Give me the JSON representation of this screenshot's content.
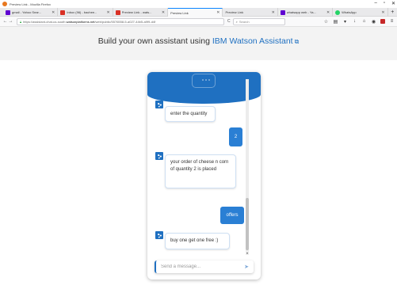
{
  "window": {
    "title": "Preview Link - Mozilla Firefox",
    "controls": [
      "–",
      "▫",
      "✕"
    ]
  },
  "tabs": [
    {
      "label": "gmail - Yahoo Sear...",
      "favicon_color": "#5f01d1"
    },
    {
      "label": "Inbox (96) - bachee...",
      "favicon_color": "#d93025"
    },
    {
      "label": "Preview Link - wats...",
      "favicon_color": "#d93025"
    },
    {
      "label": "Preview Link",
      "favicon_color": "#9e9e9e",
      "active": true
    },
    {
      "label": "Preview Link",
      "favicon_color": "#9e9e9e"
    },
    {
      "label": "whatsapp web - Ya...",
      "favicon_color": "#5f01d1"
    },
    {
      "label": "WhatsApp",
      "favicon_color": "#25d366"
    }
  ],
  "new_tab_label": "+",
  "navbar": {
    "back": "←",
    "forward": "→",
    "url_prefix": "https://assistant-chat-us-south.",
    "url_host": "watsonplatforms.net",
    "url_suffix": "/web/public/5576558-5-a027-44b5-a9f9-d4f",
    "reload": "C",
    "search_placeholder": "Search",
    "icons": [
      "star-icon",
      "library-icon",
      "pocket-icon",
      "download-icon",
      "home-icon",
      "menu-icon"
    ]
  },
  "header": {
    "prefix": "Build your own assistant using ",
    "link": "IBM Watson Assistant",
    "launch_glyph": "⧉"
  },
  "chat": {
    "messages": [
      {
        "from": "bot",
        "text": "enter the quantity"
      },
      {
        "from": "user",
        "text": "2"
      },
      {
        "from": "bot",
        "text": "your order of cheese n corn of quantity 2 is placed"
      },
      {
        "from": "user",
        "text": "offers"
      },
      {
        "from": "bot",
        "text": "buy one get one free :)"
      }
    ],
    "composer_placeholder": "Send a message...",
    "send_glyph": "➤",
    "accent": "#1f70c1",
    "user_bubble": "#2a7fd4"
  },
  "page_background": "#f3f3f3"
}
